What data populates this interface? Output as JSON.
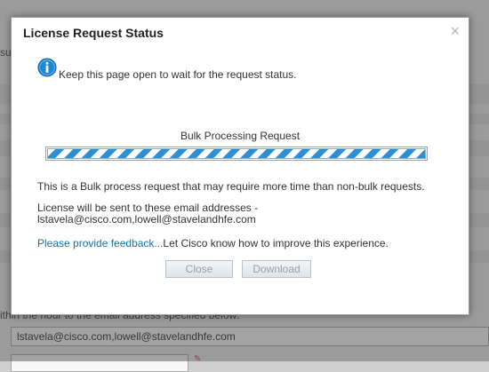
{
  "background": {
    "snippet_left": "su",
    "snippet_instruction": "ithin the hour to the email address specified below:",
    "email_field_value": "lstavela@cisco.com,lowell@stavelandhfe.com"
  },
  "dialog": {
    "title": "License Request Status",
    "close_icon": "×",
    "info_text": "Keep this page open to wait for the request status.",
    "progress_label": "Bulk Processing Request",
    "progress_state": "indeterminate",
    "bulk_message": "This is a Bulk process request that may require more time than non-bulk requests.",
    "email_message": "License will be sent to these email addresses - lstavela@cisco.com,lowell@stavelandhfe.com",
    "feedback_link": "Please provide feedback...",
    "feedback_text": "Let Cisco know how to improve this experience.",
    "buttons": {
      "close": "Close",
      "download": "Download"
    }
  },
  "colors": {
    "link": "#1c6fa8",
    "progress_stripe": "#2f8fd4",
    "info_icon": "#1b87d6"
  }
}
